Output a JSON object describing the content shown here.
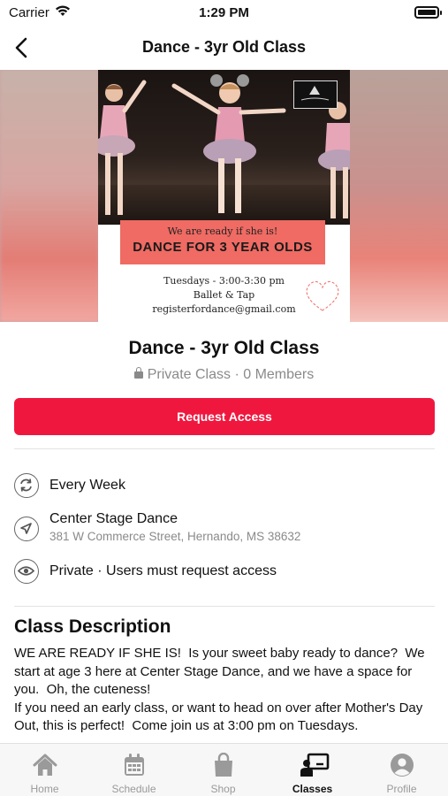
{
  "status_bar": {
    "carrier": "Carrier",
    "time": "1:29 PM"
  },
  "header": {
    "title": "Dance - 3yr Old Class"
  },
  "poster": {
    "tagline": "We are ready if she is!",
    "headline": "DANCE FOR 3 YEAR OLDS",
    "schedule": "Tuesdays - 3:00-3:30 pm",
    "styles": "Ballet & Tap",
    "email": "registerfordance@gmail.com"
  },
  "class": {
    "title": "Dance - 3yr Old Class",
    "meta": "Private Class · 0 Members",
    "request_label": "Request Access"
  },
  "details": {
    "frequency": "Every Week",
    "location_name": "Center Stage Dance",
    "location_address": "381 W Commerce Street, Hernando, MS 38632",
    "privacy": "Private · Users must request access"
  },
  "description": {
    "title": "Class Description",
    "body": "WE ARE READY IF SHE IS!  Is your sweet baby ready to dance?  We start at age 3 here at Center Stage Dance, and we have a space for you.  Oh, the cuteness!\nIf you need an early class, or want to head on over after Mother's Day Out, this is perfect!  Come join us at 3:00 pm on Tuesdays."
  },
  "tabs": [
    {
      "label": "Home",
      "icon": "home-icon"
    },
    {
      "label": "Schedule",
      "icon": "calendar-icon"
    },
    {
      "label": "Shop",
      "icon": "shopping-bag-icon"
    },
    {
      "label": "Classes",
      "icon": "classes-icon",
      "active": true
    },
    {
      "label": "Profile",
      "icon": "profile-icon"
    }
  ],
  "colors": {
    "accent": "#f0173f",
    "active_tab": "#111111",
    "inactive_tab": "#9a9a9a"
  }
}
